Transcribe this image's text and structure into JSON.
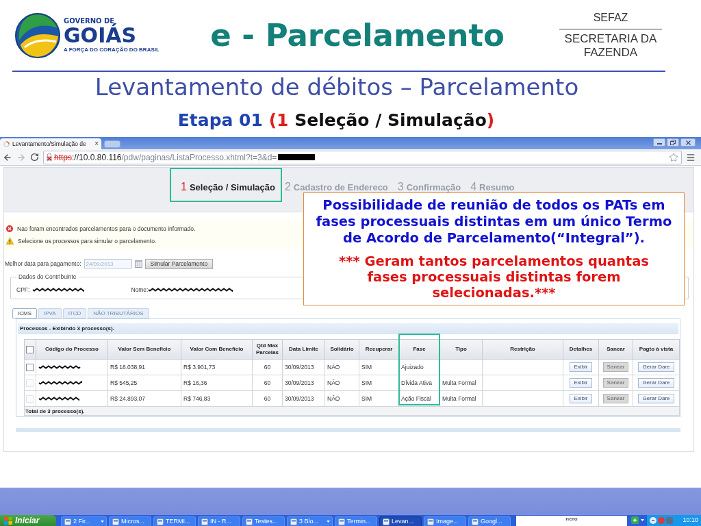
{
  "slide_header": {
    "logo": {
      "line_1": "GOVERNO DE",
      "line_2": "GOIÁS",
      "tagline": "A FORÇA DO CORAÇÃO DO BRASIL"
    },
    "title": "e - Parcelamento",
    "agency": {
      "acronym": "SEFAZ",
      "name": "SECRETARIA DA FAZENDA"
    },
    "subtitle": "Levantamento de débitos – Parcelamento",
    "stage": {
      "label": "Etapa 01",
      "open": "(",
      "number": "1",
      "name": "Seleção / Simulação",
      "close": ")"
    }
  },
  "browser": {
    "tabs": [
      {
        "title": "Levantamento/Simulação de",
        "selected": true
      }
    ],
    "close_tab": "×",
    "address": {
      "insecure": true,
      "scheme": "https",
      "host": "://10.0.80.116",
      "path": "/pdw/paginas/ListaProcesso.xhtml?t=3&d="
    }
  },
  "wizard_steps": [
    {
      "number": "1",
      "label": "Seleção / Simulação",
      "selected": true,
      "highlighted": true
    },
    {
      "number": "2",
      "label": "Cadastro de Endereco",
      "selected": false,
      "highlighted": false
    },
    {
      "number": "3",
      "label": "Confirmação",
      "selected": false,
      "highlighted": false
    },
    {
      "number": "4",
      "label": "Resumo",
      "selected": false,
      "highlighted": false
    }
  ],
  "messages": [
    {
      "kind": "error",
      "text": "Nao foram encontrados parcelamentos para o documento informado."
    },
    {
      "kind": "warning",
      "text": "Selecione os processos para simular o parcelamento."
    }
  ],
  "payment_date": {
    "label": "Melhor data para pagamento:",
    "value": "24/09/2013",
    "disabled": true
  },
  "simulate_button": "Simular Parcelamento",
  "taxpayer": {
    "legend": "Dados do Contribuinte",
    "cpf_label": "CPF:",
    "name_label": "Nome:"
  },
  "tax_tabs": [
    {
      "label": "ICMS",
      "selected": true
    },
    {
      "label": "IPVA",
      "selected": false
    },
    {
      "label": "ITCD",
      "selected": false
    },
    {
      "label": "NÃO TRIBUTÁRIOS",
      "selected": false
    }
  ],
  "processes": {
    "title": "Processos - Exibindo 3 processo(s).",
    "select_all": {
      "checked": false
    },
    "columns": [
      {
        "label": "Código do Processo",
        "highlighted": false
      },
      {
        "label": "Valor Sem Benefício",
        "highlighted": false
      },
      {
        "label": "Valor Com Benefício",
        "highlighted": false
      },
      {
        "label": "Qtd Max Parcelas",
        "highlighted": false
      },
      {
        "label": "Data Limite",
        "highlighted": false
      },
      {
        "label": "Solidário",
        "highlighted": false
      },
      {
        "label": "Recuperar",
        "highlighted": false
      },
      {
        "label": "Fase",
        "highlighted": true
      },
      {
        "label": "Tipo",
        "highlighted": false
      },
      {
        "label": "Restrição",
        "highlighted": false
      },
      {
        "label": "Detalhes",
        "highlighted": false
      },
      {
        "label": "Sanear",
        "highlighted": false
      },
      {
        "label": "Pagto à vista",
        "highlighted": false
      }
    ],
    "rows": [
      {
        "checked": false,
        "disabled": false,
        "valor_sem_beneficio": "R$ 18.038,91",
        "valor_com_beneficio": "R$ 3.901,73",
        "qtd_max_parcelas": "60",
        "data_limite": "30/09/2013",
        "solidario": "NÃO",
        "recuperar": "SIM",
        "fase": "Ajuizado",
        "actions": [
          {
            "label": "Exibir",
            "disabled": false
          },
          {
            "label": "Sanear",
            "disabled": true
          },
          {
            "label": "Gerar Dare",
            "disabled": false
          }
        ]
      },
      {
        "checked": false,
        "disabled": true,
        "valor_sem_beneficio": "R$ 545,25",
        "valor_com_beneficio": "R$ 16,36",
        "qtd_max_parcelas": "60",
        "data_limite": "30/09/2013",
        "solidario": "NÃO",
        "recuperar": "SIM",
        "fase": "Dívida Ativa",
        "tipo": "Multa Formal",
        "actions": [
          {
            "label": "Exibir",
            "disabled": false
          },
          {
            "label": "Sanear",
            "disabled": true
          },
          {
            "label": "Gerar Dare",
            "disabled": false
          }
        ]
      },
      {
        "checked": false,
        "disabled": true,
        "valor_sem_beneficio": "R$ 24.893,07",
        "valor_com_beneficio": "R$ 746,83",
        "qtd_max_parcelas": "60",
        "data_limite": "30/09/2013",
        "solidario": "NÃO",
        "recuperar": "SIM",
        "fase": "Ação Fiscal",
        "tipo": "Multa Formal",
        "actions": [
          {
            "label": "Exibir",
            "disabled": false
          },
          {
            "label": "Sanear",
            "disabled": true
          },
          {
            "label": "Gerar Dare",
            "disabled": false
          }
        ]
      }
    ],
    "footer": "Total de 3 processo(s)."
  },
  "callout": {
    "note": "Possibilidade de reunião de todos os PATs em fases processuais distintas em um único Termo de Acordo de Parcelamento(“Integral”).",
    "warning": "*** Geram tantos parcelamentos quantas fases processuais distintas forem selecionadas.***"
  },
  "taskbar": {
    "start": "Iniciar",
    "items": [
      {
        "label": "2 Fir...",
        "selected": false,
        "grouped": true
      },
      {
        "label": "Micros...",
        "selected": false,
        "grouped": false
      },
      {
        "label": "TERMI...",
        "selected": false,
        "grouped": false
      },
      {
        "label": "IN - R...",
        "selected": false,
        "grouped": false
      },
      {
        "label": "Testes...",
        "selected": false,
        "grouped": false
      },
      {
        "label": "3 Blo...",
        "selected": false,
        "grouped": true
      },
      {
        "label": "Termin...",
        "selected": false,
        "grouped": false
      },
      {
        "label": "Levan...",
        "selected": true,
        "grouped": false
      },
      {
        "label": "Image...",
        "selected": false,
        "grouped": false
      },
      {
        "label": "Googl...",
        "selected": false,
        "grouped": false
      }
    ],
    "search_logo": "nero",
    "clock": "10:10"
  }
}
